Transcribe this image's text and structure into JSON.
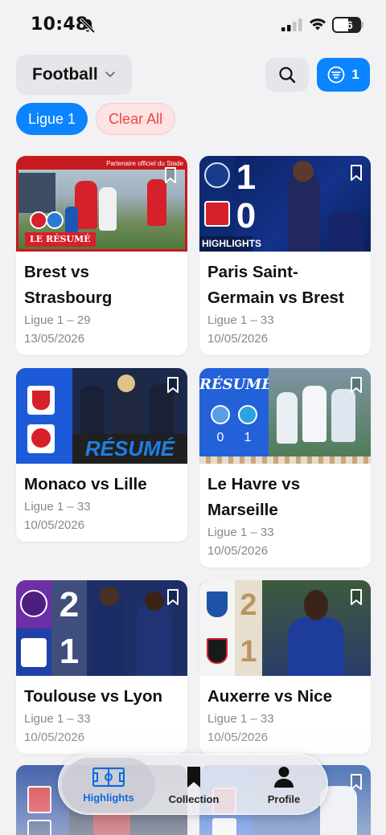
{
  "status_bar": {
    "time": "10:48",
    "battery": "56"
  },
  "header": {
    "sport": "Football",
    "filter_count": "1"
  },
  "filters": {
    "active_chip": "Ligue 1",
    "clear_label": "Clear All"
  },
  "colors": {
    "accent": "#0a84ff",
    "clear_text": "#ef4444",
    "clear_bg": "#fde3e3"
  },
  "matches": [
    {
      "title": "Brest vs Strasbourg",
      "competition": "Ligue 1 – 29",
      "date": "13/05/2026",
      "thumb_text": "LE RÉSUMÉ",
      "thumb_banner": "Partenaire officiel du Stade"
    },
    {
      "title": "Paris Saint-Germain vs Brest",
      "competition": "Ligue 1 – 33",
      "date": "10/05/2026",
      "thumb_text": "HIGHLIGHTS",
      "score_home": "1",
      "score_away": "0"
    },
    {
      "title": "Monaco vs Lille",
      "competition": "Ligue 1 – 33",
      "date": "10/05/2026",
      "thumb_text": "RÉSUMÉ"
    },
    {
      "title": "Le Havre vs Marseille",
      "competition": "Ligue 1 – 33",
      "date": "10/05/2026",
      "thumb_text": "RÉSUMÉ",
      "score_home": "0",
      "score_away": "1"
    },
    {
      "title": "Toulouse vs Lyon",
      "competition": "Ligue 1 – 33",
      "date": "10/05/2026",
      "score_home": "2",
      "score_away": "1"
    },
    {
      "title": "Auxerre vs Nice",
      "competition": "Ligue 1 – 33",
      "date": "10/05/2026",
      "score_home": "2",
      "score_away": "1"
    }
  ],
  "tab_bar": {
    "tabs": [
      {
        "label": "Highlights",
        "icon": "pitch-icon",
        "active": true
      },
      {
        "label": "Collection",
        "icon": "bookmark-icon",
        "active": false
      },
      {
        "label": "Profile",
        "icon": "person-icon",
        "active": false
      }
    ]
  }
}
